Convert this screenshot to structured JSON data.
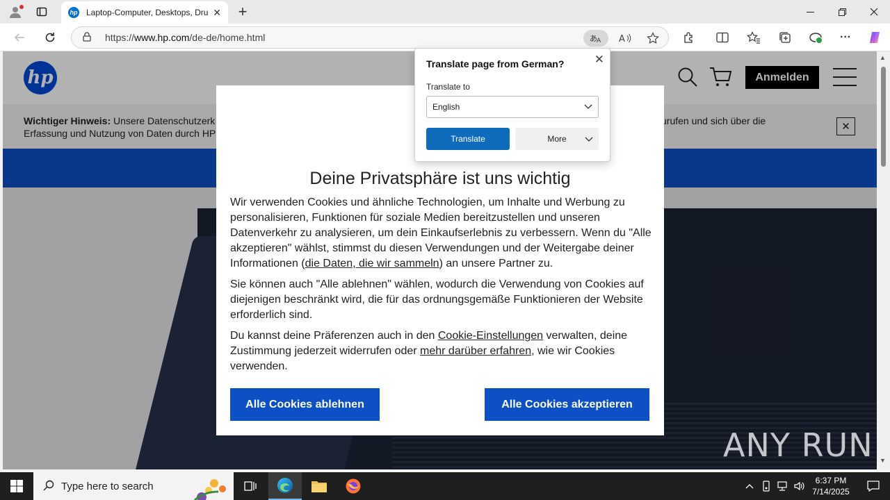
{
  "browser": {
    "tab_title": "Laptop-Computer, Desktops, Drucker",
    "url_prefix": "https://",
    "url_host": "www.hp.com",
    "url_path": "/de-de/home.html"
  },
  "hp": {
    "logo_text": "hp",
    "login_label": "Anmelden",
    "notice_bold": "Wichtiger Hinweis:",
    "notice_line1": " Unsere Datenschutzerk",
    "notice_line2": "Erfassung und Nutzung von Daten durch HP",
    "notice_right": "zurufen und sich über die"
  },
  "cookie": {
    "title": "Deine Privatsphäre ist uns wichtig",
    "p1_a": "Wir verwenden Cookies und ähnliche Technologien, um Inhalte und Werbung zu personalisieren, Funktionen für soziale Medien bereitzustellen und unseren Datenverkehr zu analysieren, um dein Einkaufserlebnis zu verbessern. Wenn du \"Alle akzeptieren\" wählst, stimmst du diesen Verwendungen und der Weitergabe deiner Informationen (",
    "p1_link": "die Daten, die wir sammeln",
    "p1_b": ") an unsere Partner zu.",
    "p2": "Sie können auch \"Alle ablehnen\" wählen, wodurch die Verwendung von Cookies auf diejenigen beschränkt wird, die für das ordnungsgemäße Funktionieren der Website erforderlich sind.",
    "p3_a": "Du kannst deine Präferenzen auch in den ",
    "p3_link1": "Cookie-Einstellungen",
    "p3_b": " verwalten, deine Zustimmung jederzeit widerrufen oder ",
    "p3_link2": "mehr darüber erfahren",
    "p3_c": ", wie wir Cookies verwenden.",
    "reject_label": "Alle Cookies ablehnen",
    "accept_label": "Alle Cookies akzeptieren"
  },
  "translate": {
    "title": "Translate page from German?",
    "to_label": "Translate to",
    "selected_language": "English",
    "translate_label": "Translate",
    "more_label": "More"
  },
  "watermark": "ANY RUN",
  "taskbar": {
    "search_placeholder": "Type here to search",
    "time": "6:37 PM",
    "date": "7/14/2025"
  },
  "colors": {
    "hp_blue": "#0e4fc5",
    "edge_blue": "#0f6cbd",
    "button_blue": "#0d50c6"
  }
}
